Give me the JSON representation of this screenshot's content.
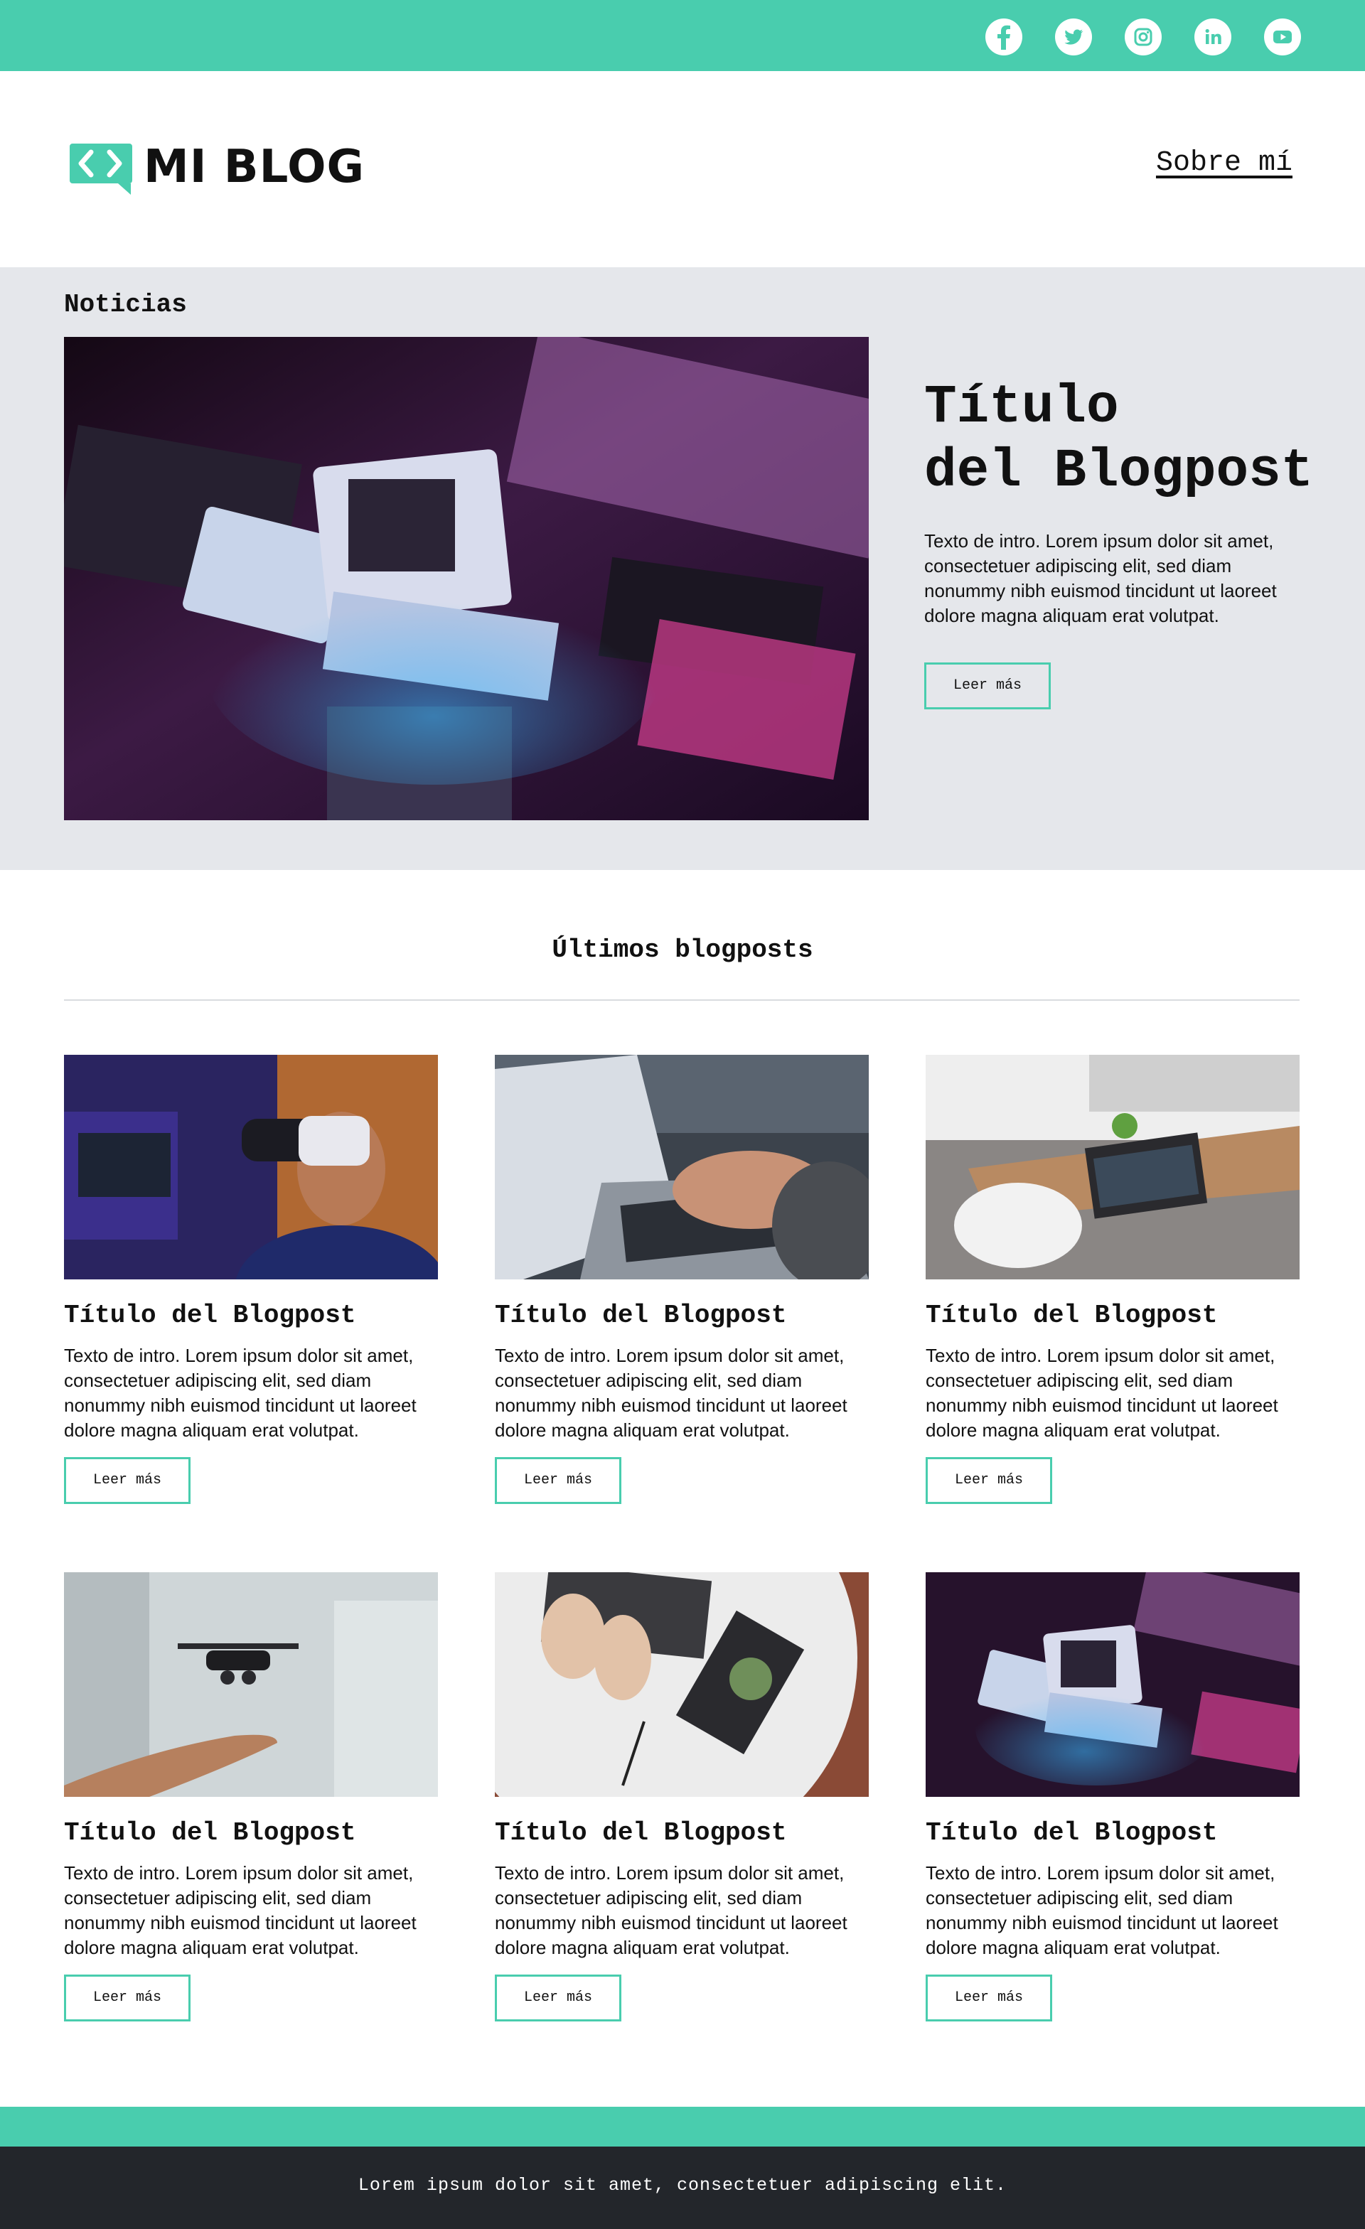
{
  "colors": {
    "accent": "#49cdae",
    "band": "#e5e7eb",
    "footer": "#23262b"
  },
  "social": [
    "facebook-icon",
    "twitter-icon",
    "instagram-icon",
    "linkedin-icon",
    "youtube-icon"
  ],
  "header": {
    "logo_text": "MI BLOG",
    "nav_about": "Sobre mí"
  },
  "featured": {
    "section_label": "Noticias",
    "title_line1": "Título",
    "title_line2": "del Blogpost",
    "intro": "Texto de intro. Lorem ipsum dolor sit amet, consectetuer adipiscing elit, sed diam nonummy nibh euismod tincidunt ut laoreet dolore magna aliquam erat volutpat.",
    "button": "Leer más"
  },
  "latest": {
    "heading": "Últimos blogposts",
    "posts": [
      {
        "title": "Título del Blogpost",
        "intro": "Texto de intro. Lorem ipsum dolor sit amet, consectetuer adipiscing elit, sed diam nonummy nibh euismod tincidunt ut laoreet dolore magna aliquam erat volutpat.",
        "button": "Leer más"
      },
      {
        "title": "Título del Blogpost",
        "intro": "Texto de intro. Lorem ipsum dolor sit amet, consectetuer adipiscing elit, sed diam nonummy nibh euismod tincidunt ut laoreet dolore magna aliquam erat volutpat.",
        "button": "Leer más"
      },
      {
        "title": "Título del Blogpost",
        "intro": "Texto de intro. Lorem ipsum dolor sit amet, consectetuer adipiscing elit, sed diam nonummy nibh euismod tincidunt ut laoreet dolore magna aliquam erat volutpat.",
        "button": "Leer más"
      },
      {
        "title": "Título del Blogpost",
        "intro": "Texto de intro. Lorem ipsum dolor sit amet, consectetuer adipiscing elit, sed diam nonummy nibh euismod tincidunt ut laoreet dolore magna aliquam erat volutpat.",
        "button": "Leer más"
      },
      {
        "title": "Título del Blogpost",
        "intro": "Texto de intro. Lorem ipsum dolor sit amet, consectetuer adipiscing elit, sed diam nonummy nibh euismod tincidunt ut laoreet dolore magna aliquam erat volutpat.",
        "button": "Leer más"
      },
      {
        "title": "Título del Blogpost",
        "intro": "Texto de intro. Lorem ipsum dolor sit amet, consectetuer adipiscing elit, sed diam nonummy nibh euismod tincidunt ut laoreet dolore magna aliquam erat volutpat.",
        "button": "Leer más"
      }
    ]
  },
  "footer": {
    "text": "Lorem ipsum dolor sit amet, consectetuer adipiscing elit."
  }
}
